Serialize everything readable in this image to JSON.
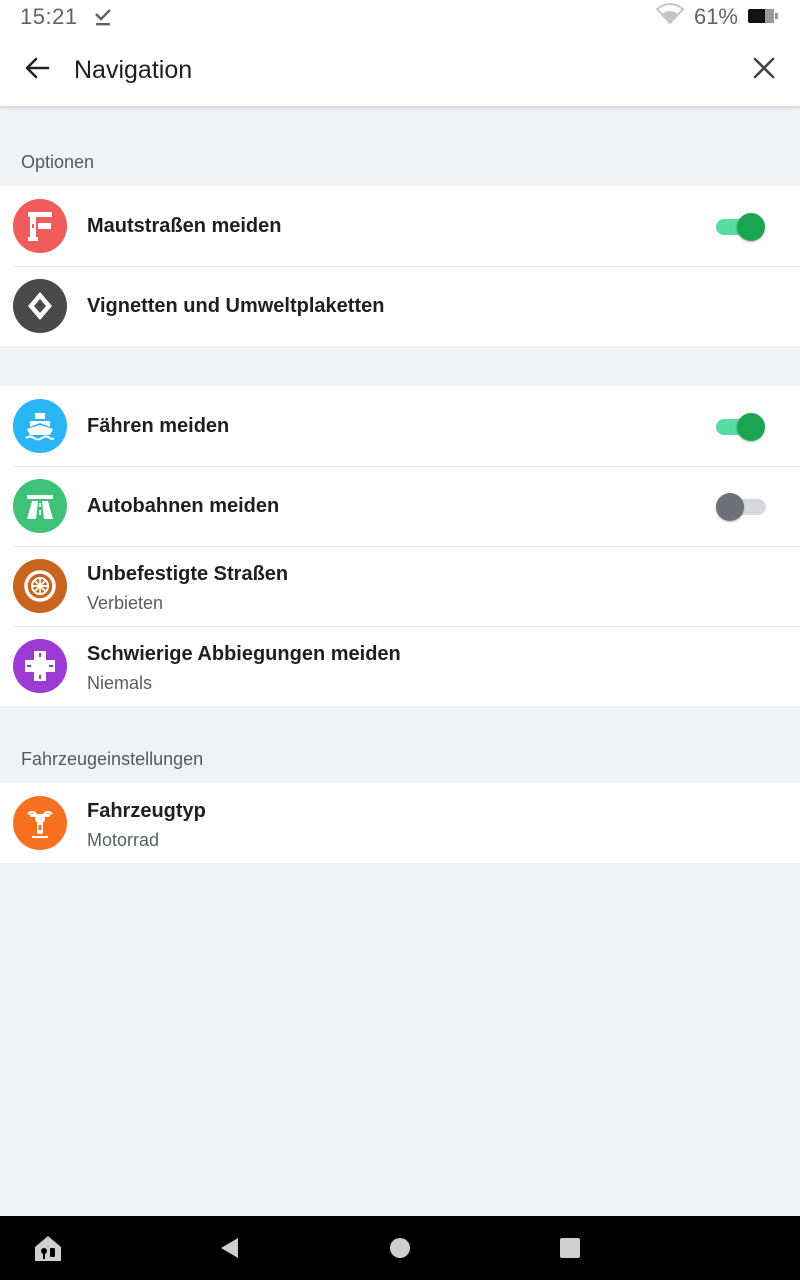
{
  "status_bar": {
    "time": "15:21",
    "battery_percent": "61%",
    "icons": [
      "download-done-icon",
      "wifi-icon",
      "battery-icon"
    ]
  },
  "app_bar": {
    "title": "Navigation",
    "back_icon": "arrow-back-icon",
    "close_icon": "close-icon"
  },
  "sections": {
    "options_label": "Optionen",
    "vehicle_label": "Fahrzeugeinstellungen"
  },
  "group1": [
    {
      "title": "Mautstraßen meiden",
      "icon": "toll-barrier-icon",
      "icon_color": "#f05b5b",
      "toggle": true
    },
    {
      "title": "Vignetten und Umweltplaketten",
      "icon": "vignette-diamond-icon",
      "icon_color": "#4a4a4a"
    }
  ],
  "group2": [
    {
      "title": "Fähren meiden",
      "icon": "ferry-icon",
      "icon_color": "#29b6f6",
      "toggle": true
    },
    {
      "title": "Autobahnen meiden",
      "icon": "highway-icon",
      "icon_color": "#3ec27a",
      "toggle": false
    },
    {
      "title": "Unbefestigte Straßen",
      "subtitle": "Verbieten",
      "icon": "tire-icon",
      "icon_color": "#c8641e"
    },
    {
      "title": "Schwierige Abbiegungen meiden",
      "subtitle": "Niemals",
      "icon": "intersection-icon",
      "icon_color": "#9c3bd4"
    }
  ],
  "group3": [
    {
      "title": "Fahrzeugtyp",
      "subtitle": "Motorrad",
      "icon": "motorcycle-icon",
      "icon_color": "#f7701f"
    }
  ],
  "nav_bar": {
    "icons": [
      "home-lock-icon",
      "back-triangle-icon",
      "home-circle-icon",
      "recents-square-icon"
    ]
  }
}
